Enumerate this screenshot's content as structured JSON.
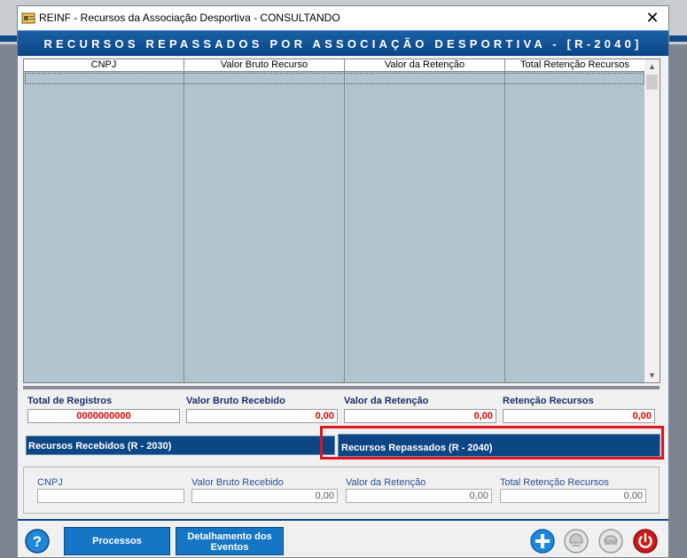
{
  "window": {
    "title": "REINF - Recursos da Associação Desportiva   -   CONSULTANDO",
    "close_glyph": "✕"
  },
  "header": {
    "title": "RECURSOS REPASSADOS POR ASSOCIAÇÃO DESPORTIVA - [R-2040]"
  },
  "grid": {
    "columns": [
      "CNPJ",
      "Valor Bruto Recurso",
      "Valor da Retenção",
      "Total Retenção Recursos"
    ],
    "rows": []
  },
  "totals": {
    "labels": [
      "Total de Registros",
      "Valor Bruto Recebido",
      "Valor da Retenção",
      "Retenção Recursos"
    ],
    "values": [
      "0000000000",
      "0,00",
      "0,00",
      "0,00"
    ]
  },
  "tabs": {
    "tab_a": "Recursos Recebidos (R - 2030)",
    "tab_b": "Recursos Repassados (R - 2040)",
    "active": "tab_b"
  },
  "detail": {
    "labels": [
      "CNPJ",
      "Valor Bruto Recebido",
      "Valor da Retenção",
      "Total Retenção Recursos"
    ],
    "values": [
      "",
      "0,00",
      "0,00",
      "0,00"
    ]
  },
  "footer": {
    "help_glyph": "?",
    "processos_label": "Processos",
    "detalhamento_label": "Detalhamento dos Eventos"
  },
  "colors": {
    "header_blue": "#0d4685",
    "grid_bg": "#b0c4ce",
    "total_red": "#e00000",
    "highlight_red": "#e0141c",
    "power_red": "#cc1a1a",
    "add_blue": "#1e88d8"
  }
}
